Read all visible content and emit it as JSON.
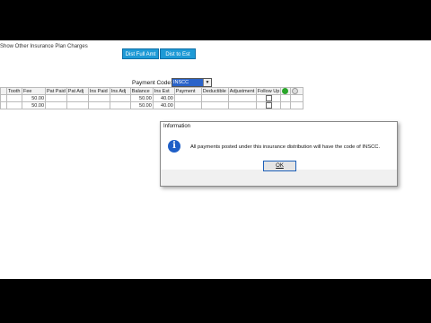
{
  "top_bar": {
    "show_other_label": "Show Other Insurance Plan Charges",
    "dist_full_amt_label": "Dist Full Amt",
    "dist_to_est_label": "Dist to Est"
  },
  "payment_code": {
    "label": "Payment Code:",
    "value": "INSCC"
  },
  "grid": {
    "headers": [
      "Tooth",
      "Fee",
      "Pat Paid",
      "Pat Adj",
      "Ins Paid",
      "Ins Adj",
      "Balance",
      "Ins Est",
      "Payment",
      "Deductible",
      "Adjustment",
      "Follow Up"
    ],
    "rows": [
      [
        "",
        "50.00",
        "",
        "",
        "",
        "",
        "50.00",
        "40.00",
        "",
        "",
        "",
        ""
      ],
      [
        "",
        "50.00",
        "",
        "",
        "",
        "",
        "50.00",
        "40.00",
        "",
        "",
        "",
        ""
      ]
    ]
  },
  "dialog": {
    "title": "Information",
    "message": "All payments posted under this insurance distribution will have the code of INSCC.",
    "ok_label": "OK"
  }
}
